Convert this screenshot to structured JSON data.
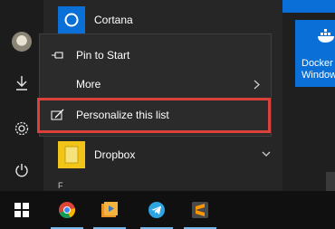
{
  "start_menu": {
    "apps": [
      {
        "label": "Cortana",
        "icon": "cortana-icon"
      },
      {
        "label": "Dropbox",
        "icon": "dropbox-icon"
      }
    ],
    "group_letter": "F",
    "dropbox_expand_icon": "chevron-down-icon"
  },
  "context_menu": {
    "items": [
      {
        "label": "Pin to Start",
        "icon": "pin-icon"
      },
      {
        "label": "More",
        "icon": "",
        "submenu_icon": "chevron-right-icon"
      },
      {
        "label": "Personalize this list",
        "icon": "personalize-icon"
      }
    ]
  },
  "tiles": {
    "docker": {
      "label_line1": "Docker",
      "label_line2": "Window"
    }
  },
  "taskbar": {
    "apps": [
      "windows-start-icon",
      "chrome-icon",
      "media-player-icon",
      "telegram-icon",
      "sublime-text-icon"
    ]
  },
  "colors": {
    "accent": "#0a6fd6",
    "highlight_border": "#d9413a",
    "menu_bg": "#2b2b2b"
  }
}
